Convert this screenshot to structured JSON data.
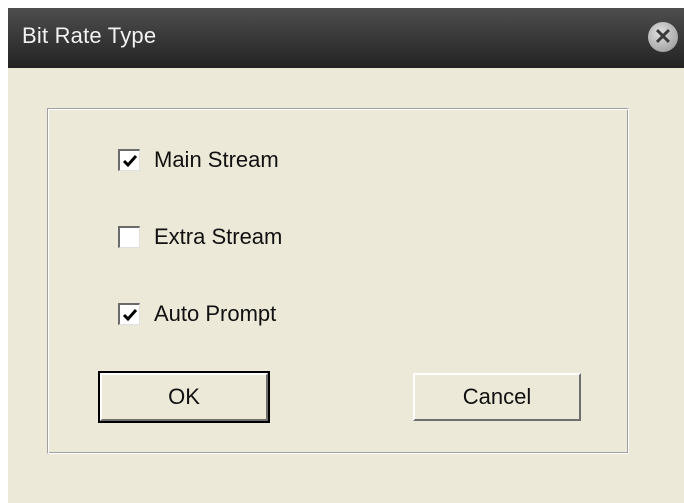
{
  "dialog": {
    "title": "Bit Rate Type",
    "close_icon": "close-icon"
  },
  "options": [
    {
      "label": "Main Stream",
      "checked": true
    },
    {
      "label": "Extra Stream",
      "checked": false
    },
    {
      "label": "Auto Prompt",
      "checked": true
    }
  ],
  "buttons": {
    "ok_label": "OK",
    "cancel_label": "Cancel"
  }
}
